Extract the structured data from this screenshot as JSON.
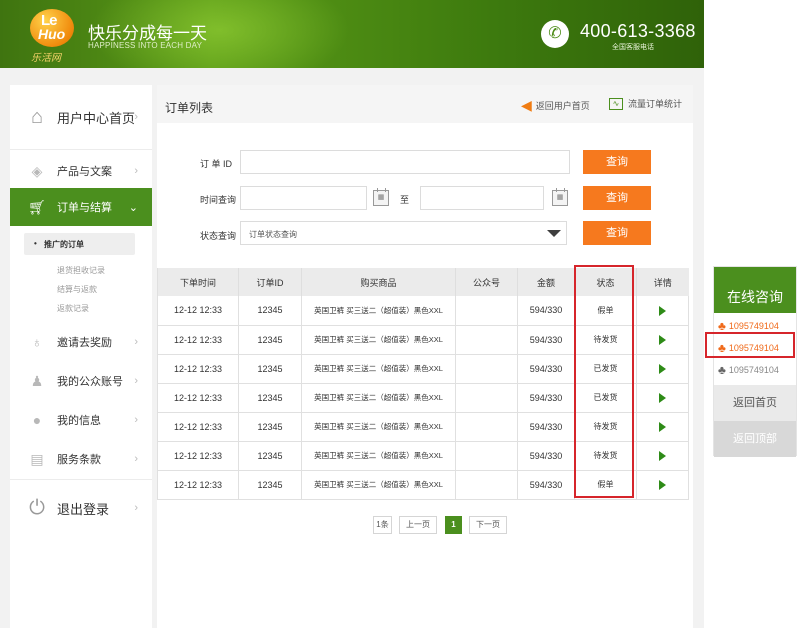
{
  "header": {
    "logo_le": "Le",
    "logo_huo": "Huo",
    "logo_cn": "乐活网",
    "slogan_cn": "快乐分成每一天",
    "slogan_en": "HAPPINESS INTO EACH DAY",
    "phone": "400-613-3368",
    "phone_sub": "全国客服电话"
  },
  "sidebar": {
    "home": "用户中心首页",
    "items": [
      {
        "label": "产品与文案"
      },
      {
        "label": "订单与结算"
      },
      {
        "label": "邀请去奖励"
      },
      {
        "label": "我的公众账号"
      },
      {
        "label": "我的信息"
      },
      {
        "label": "服务条款"
      }
    ],
    "sub": [
      "推广的订单",
      "退货担收记录",
      "结算与返款",
      "返款记录"
    ],
    "sub_dot": "•",
    "logout": "退出登录"
  },
  "main": {
    "title": "订单列表",
    "back_label": "返回用户首页",
    "stat_label": "流量订单统计",
    "order_id_label": "订 单 ID",
    "time_label": "时间查询",
    "to_label": "至",
    "status_label": "状态查询",
    "status_select": "订单状态查询",
    "query": "查询"
  },
  "table": {
    "headers": [
      "下单时间",
      "订单ID",
      "购买商品",
      "公众号",
      "金额",
      "状态",
      "详情"
    ],
    "rows": [
      {
        "time": "12-12  12:33",
        "id": "12345",
        "goods": "英国卫裤  买三送二（超值装）黑色XXL",
        "account": "",
        "amount": "594/330",
        "status": "假单"
      },
      {
        "time": "12-12  12:33",
        "id": "12345",
        "goods": "英国卫裤  买三送二（超值装）黑色XXL",
        "account": "",
        "amount": "594/330",
        "status": "待发货"
      },
      {
        "time": "12-12  12:33",
        "id": "12345",
        "goods": "英国卫裤  买三送二（超值装）黑色XXL",
        "account": "",
        "amount": "594/330",
        "status": "已发货"
      },
      {
        "time": "12-12  12:33",
        "id": "12345",
        "goods": "英国卫裤  买三送二（超值装）黑色XXL",
        "account": "",
        "amount": "594/330",
        "status": "已发货"
      },
      {
        "time": "12-12  12:33",
        "id": "12345",
        "goods": "英国卫裤  买三送二（超值装）黑色XXL",
        "account": "",
        "amount": "594/330",
        "status": "待发货"
      },
      {
        "time": "12-12  12:33",
        "id": "12345",
        "goods": "英国卫裤  买三送二（超值装）黑色XXL",
        "account": "",
        "amount": "594/330",
        "status": "待发货"
      },
      {
        "time": "12-12  12:33",
        "id": "12345",
        "goods": "英国卫裤  买三送二（超值装）黑色XXL",
        "account": "",
        "amount": "594/330",
        "status": "假单"
      }
    ]
  },
  "pager": {
    "count": "1条",
    "prev": "上一页",
    "current": "1",
    "next": "下一页"
  },
  "float": {
    "title": "在线咨询",
    "qq": [
      "1095749104",
      "1095749104",
      "1095749104"
    ],
    "home": "返回首页",
    "top": "返回顶部"
  },
  "colors": {
    "brand_green": "#4b8f1e",
    "accent_orange": "#f6791e",
    "highlight_red": "#d6252b"
  }
}
